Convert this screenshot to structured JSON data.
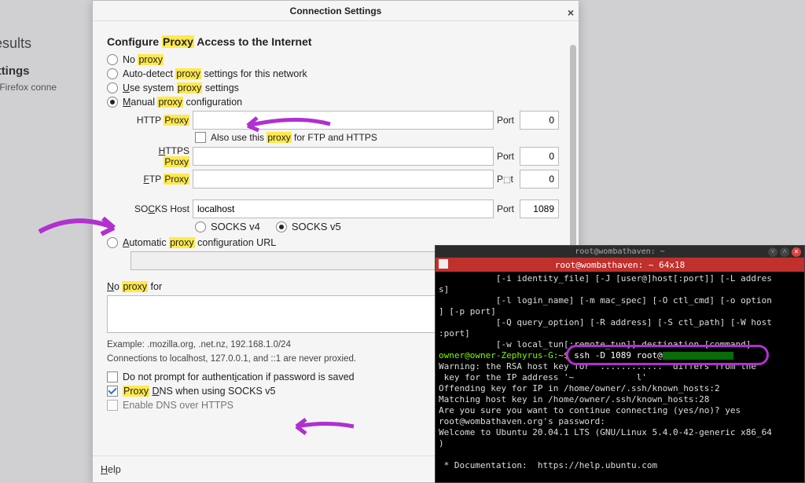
{
  "background": {
    "results": "h Results",
    "network": "rk Settings",
    "subtext": "re how Firefox conne"
  },
  "dialog": {
    "title": "Connection Settings",
    "heading_pre": "Configure ",
    "heading_hl": "Proxy",
    "heading_post": " Access to the Internet",
    "radios": {
      "no_proxy_pre": "No ",
      "no_proxy_hl": "proxy",
      "auto_pre": "Auto-detect ",
      "auto_hl": "proxy",
      "auto_post": " settings for this network",
      "sys_pre": "Use system ",
      "sys_hl": "proxy",
      "sys_post": " settings",
      "man_pre": "Manual ",
      "man_hl": "proxy",
      "man_post": " configuration",
      "autourl_pre": "Automatic ",
      "autourl_hl": "proxy",
      "autourl_post": " configuration URL"
    },
    "labels": {
      "http": "HTTP ",
      "http_hl": "Proxy",
      "also_pre": "Also use this ",
      "also_hl": "proxy",
      "also_post": " for FTP and HTTPS",
      "also_u_letter": "A",
      "https": "HTTPS ",
      "https_hl": "Proxy",
      "https_u": "H",
      "ftp": "FTP ",
      "ftp_hl": "Proxy",
      "ftp_u": "F",
      "socks": "SOCKS Host",
      "socks_u": "C",
      "port": "Port",
      "socks4": "SOCKS v4",
      "socks4_u": "4",
      "socks5": "SOCKS v5",
      "socks5_u": "5",
      "url_u": "U",
      "man_u": "M",
      "sys_u": "U",
      "noproxy": "No ",
      "noproxy_hl": "proxy",
      "noproxy_post": " for",
      "noproxy_u": "N"
    },
    "values": {
      "http": "",
      "http_port": "0",
      "https": "",
      "https_port": "0",
      "ftp": "",
      "ftp_port": "0",
      "socks": "localhost",
      "socks_port": "1089"
    },
    "example": "Example: .mozilla.org, .net.nz, 192.168.1.0/24",
    "never": "Connections to localhost, 127.0.0.1, and ::1 are never proxied.",
    "chk_noauth": "Do not prompt for authentication if password is saved",
    "chk_noauth_u": "i",
    "chk_dns_pre": "",
    "chk_dns_hl": "Proxy",
    "chk_dns_mid": " DNS when using SOCKS v5",
    "chk_dns_u": "D",
    "chk_doh": "Enable DNS over HTTPS",
    "help": "Help",
    "help_u": "H"
  },
  "terminal": {
    "top_title": "root@wombathaven: ~",
    "red_title": "root@wombathaven: ~ 64x18",
    "lines": [
      "           [-i identity_file] [-J [user@]host[:port]] [-L addres",
      "s]",
      "           [-l login_name] [-m mac_spec] [-O ctl_cmd] [-o option",
      "] [-p port]",
      "           [-Q query_option] [-R address] [-S ctl_path] [-W host",
      ":port]",
      "           [-w local_tun[:remote_tun]] destination [command]"
    ],
    "prompt_user": "owner@owner-Zephyrus-G:",
    "prompt_sym": "~$ ",
    "command": "ssh -D 1089 root@",
    "post": [
      "Warning: the RSA host key for '............' differs from the",
      " key for the IP address '~            l'",
      "Offending key for IP in /home/owner/.ssh/known_hosts:2",
      "Matching host key in /home/owner/.ssh/known_hosts:28",
      "Are you sure you want to continue connecting (yes/no)? yes",
      "root@wombathaven.org's password:",
      "Welcome to Ubuntu 20.04.1 LTS (GNU/Linux 5.4.0-42-generic x86_64",
      ")",
      "",
      " * Documentation:  https://help.ubuntu.com"
    ]
  }
}
